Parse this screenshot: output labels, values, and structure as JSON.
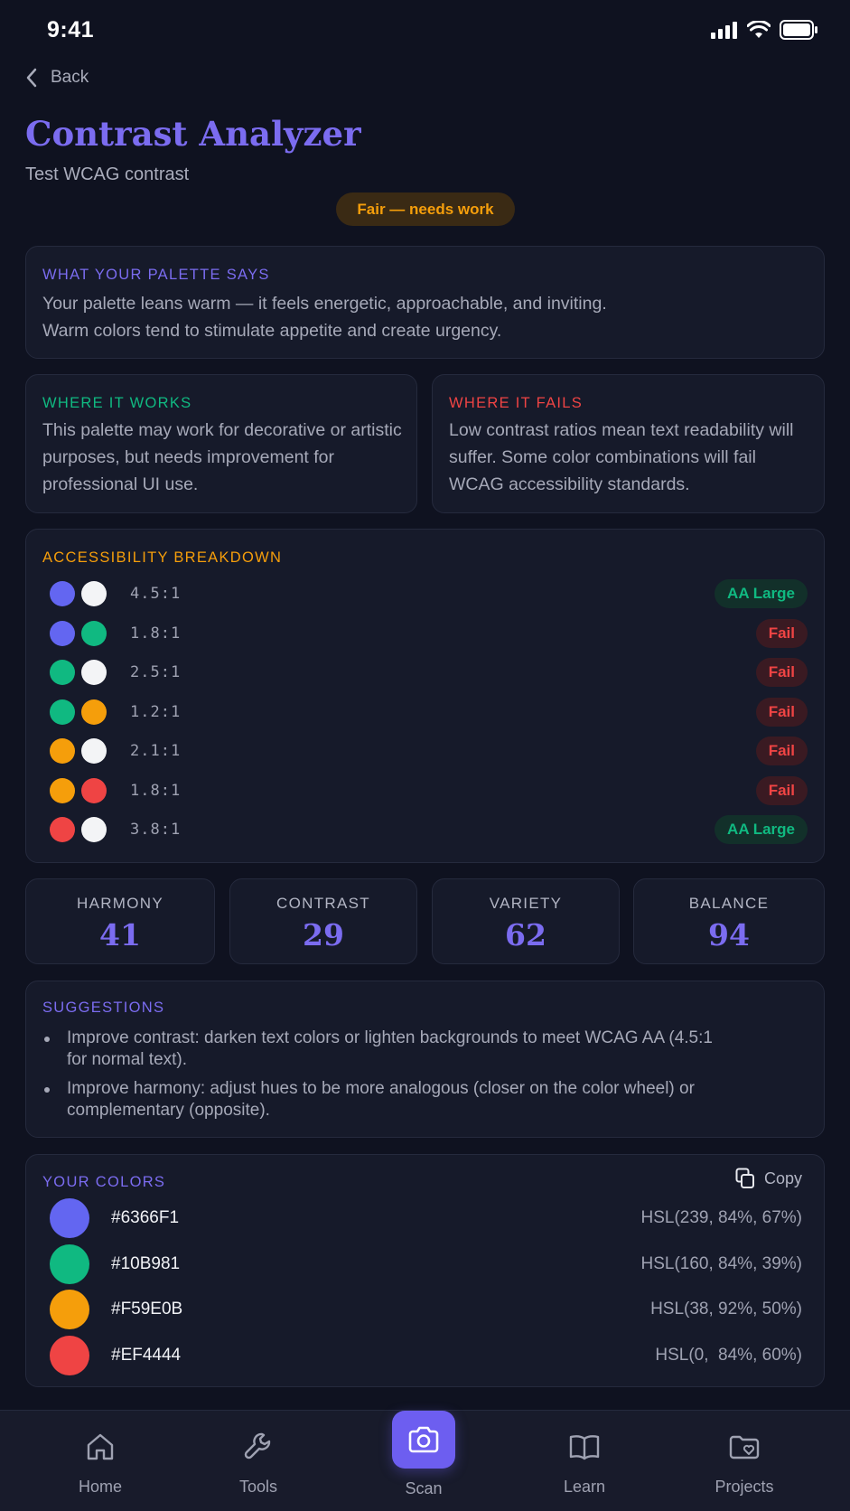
{
  "status": {
    "time": "9:41"
  },
  "nav": {
    "back_label": "Back"
  },
  "header": {
    "title": "Contrast Analyzer",
    "subtitle": "Test WCAG contrast",
    "verdict": "Fair — needs work"
  },
  "palette_says": {
    "heading": "WHAT YOUR PALETTE SAYS",
    "line1": "Your palette leans warm — it feels energetic, approachable, and inviting.",
    "line2": "Warm colors tend to stimulate appetite and create urgency."
  },
  "works": {
    "heading": "WHERE IT WORKS",
    "text": "This palette may work for decorative or artistic purposes, but needs improvement for professional UI use."
  },
  "fails": {
    "heading": "WHERE IT FAILS",
    "text": "Low contrast ratios mean text readability will suffer. Some color combinations will fail WCAG accessibility standards."
  },
  "accessibility": {
    "heading": "ACCESSIBILITY BREAKDOWN",
    "rows": [
      {
        "a": "#6366F1",
        "b": "#F3F4F6",
        "ratio": "4.5:1",
        "result": "AA Large",
        "pass": true
      },
      {
        "a": "#6366F1",
        "b": "#10B981",
        "ratio": "1.8:1",
        "result": "Fail",
        "pass": false
      },
      {
        "a": "#10B981",
        "b": "#F3F4F6",
        "ratio": "2.5:1",
        "result": "Fail",
        "pass": false
      },
      {
        "a": "#10B981",
        "b": "#F59E0B",
        "ratio": "1.2:1",
        "result": "Fail",
        "pass": false
      },
      {
        "a": "#F59E0B",
        "b": "#F3F4F6",
        "ratio": "2.1:1",
        "result": "Fail",
        "pass": false
      },
      {
        "a": "#F59E0B",
        "b": "#EF4444",
        "ratio": "1.8:1",
        "result": "Fail",
        "pass": false
      },
      {
        "a": "#EF4444",
        "b": "#F3F4F6",
        "ratio": "3.8:1",
        "result": "AA Large",
        "pass": true
      }
    ]
  },
  "scores": [
    {
      "label": "HARMONY",
      "value": "41"
    },
    {
      "label": "CONTRAST",
      "value": "29"
    },
    {
      "label": "VARIETY",
      "value": "62"
    },
    {
      "label": "BALANCE",
      "value": "94"
    }
  ],
  "suggestions": {
    "heading": "SUGGESTIONS",
    "items": [
      "Improve contrast: darken text colors or lighten backgrounds to meet WCAG AA (4.5:1 for normal text).",
      "Improve harmony: adjust hues to be more analogous (closer on the color wheel) or complementary (opposite)."
    ]
  },
  "colors": {
    "heading": "YOUR COLORS",
    "copy_label": "Copy",
    "items": [
      {
        "hex": "#6366F1",
        "hsl": "HSL(239, 84%, 67%)"
      },
      {
        "hex": "#10B981",
        "hsl": "HSL(160, 84%, 39%)"
      },
      {
        "hex": "#F59E0B",
        "hsl": "HSL(38, 92%, 50%)"
      },
      {
        "hex": "#EF4444",
        "hsl": "HSL(0,  84%, 60%)"
      }
    ]
  },
  "tabs": [
    {
      "label": "Home",
      "icon": "home-icon"
    },
    {
      "label": "Tools",
      "icon": "wrench-icon"
    },
    {
      "label": "Scan",
      "icon": "camera-icon"
    },
    {
      "label": "Learn",
      "icon": "book-icon"
    },
    {
      "label": "Projects",
      "icon": "folder-heart-icon"
    }
  ],
  "theme": {
    "accent": "#7B6CF0",
    "pass": "#10B981",
    "fail": "#EF4444",
    "warning": "#F59E0B",
    "background": "#0F1220"
  }
}
